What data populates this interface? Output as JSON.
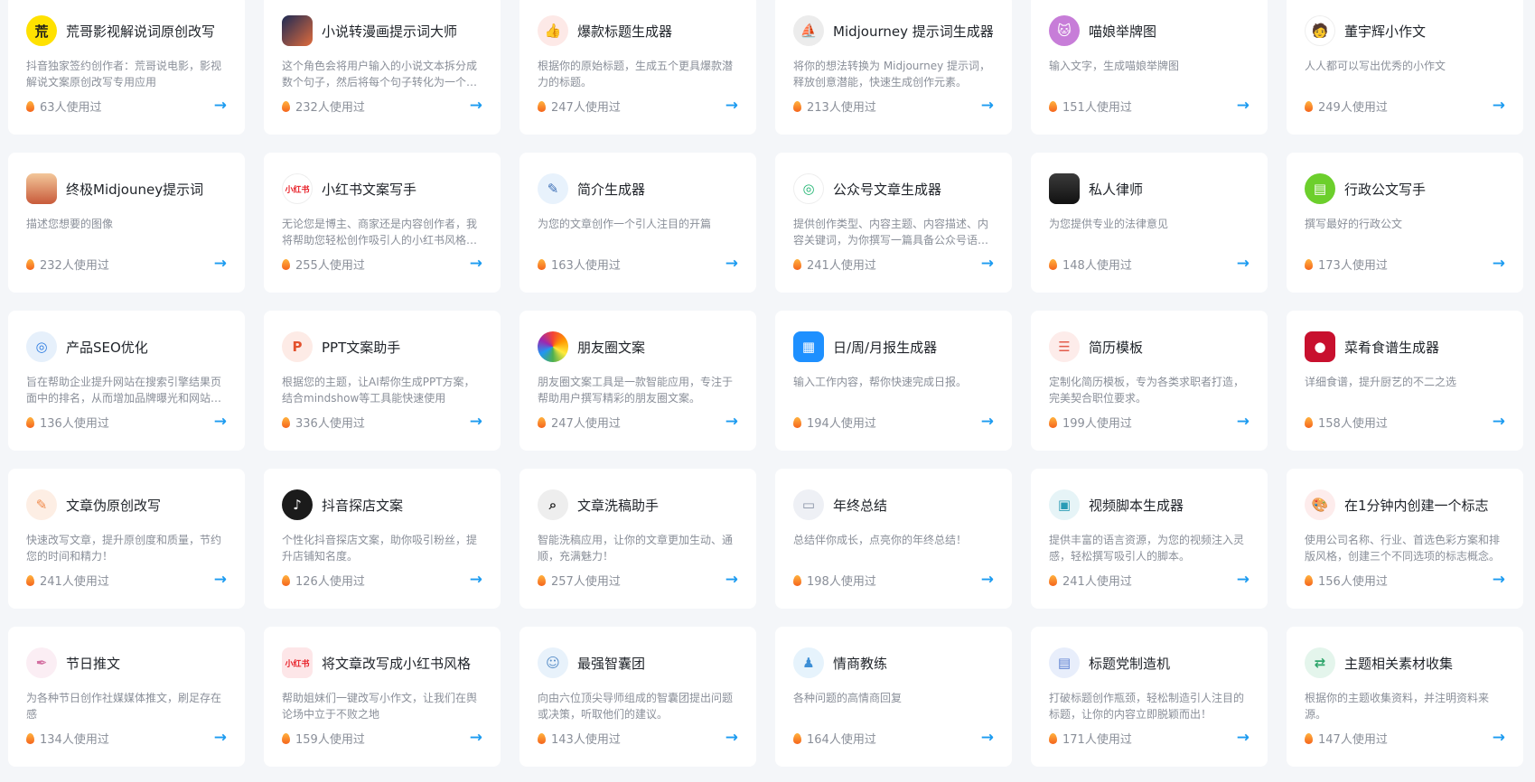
{
  "cards": [
    {
      "title": "荒哥影视解说词原创改写",
      "desc": "抖音独家签约创作者：荒哥说电影，影视解说文案原创改写专用应用",
      "uses": "63人使用过",
      "icon": "huang-ge-logo-icon",
      "glyph": "荒",
      "bg": "#ffe100",
      "fg": "#1b1b1b",
      "shape": "circle"
    },
    {
      "title": "小说转漫画提示词大师",
      "desc": "这个角色会将用户输入的小说文本拆分成数个句子，然后将每个句子转化为一个漫画分镜",
      "uses": "232人使用过",
      "icon": "comic-scene-icon",
      "glyph": "",
      "bg": "linear-gradient(135deg,#1c2a55,#e06b3c)",
      "fg": "#fff",
      "shape": "sq"
    },
    {
      "title": "爆款标题生成器",
      "desc": "根据你的原始标题，生成五个更具爆款潜力的标题。",
      "uses": "247人使用过",
      "icon": "thumbs-up-icon",
      "glyph": "👍",
      "bg": "#fde9e7",
      "fg": "#ef5b45",
      "shape": "circle"
    },
    {
      "title": "Midjourney 提示词生成器",
      "desc": "将你的想法转换为 Midjourney 提示词，释放创意潜能，快速生成创作元素。",
      "uses": "213人使用过",
      "icon": "sailboat-icon",
      "glyph": "⛵",
      "bg": "#ececec",
      "fg": "#333",
      "shape": "circle"
    },
    {
      "title": "喵娘举牌图",
      "desc": "输入文字，生成喵娘举牌图",
      "uses": "151人使用过",
      "icon": "cat-avatar-icon",
      "glyph": "🐱",
      "bg": "#c77dd8",
      "fg": "#fff",
      "shape": "circle"
    },
    {
      "title": "董宇辉小作文",
      "desc": "人人都可以写出优秀的小作文",
      "uses": "249人使用过",
      "icon": "person-avatar-icon",
      "glyph": "🧑",
      "bg": "#ffffff",
      "fg": "#333",
      "shape": "circle"
    },
    {
      "title": "终极Midjouney提示词",
      "desc": "描述您想要的图像",
      "uses": "232人使用过",
      "icon": "sunset-boat-icon",
      "glyph": "",
      "bg": "linear-gradient(180deg,#f3c79a,#c85a3a)",
      "fg": "#fff",
      "shape": "sq"
    },
    {
      "title": "小红书文案写手",
      "desc": "无论您是博主、商家还是内容创作者，我将帮助您轻松创作吸引人的小红书风格文案",
      "uses": "255人使用过",
      "icon": "xiaohongshu-logo-icon",
      "glyph": "小红书",
      "bg": "#ffffff",
      "fg": "#e8242c",
      "shape": "circle"
    },
    {
      "title": "简介生成器",
      "desc": "为您的文章创作一个引人注目的开篇",
      "uses": "163人使用过",
      "icon": "edit-document-icon",
      "glyph": "✎",
      "bg": "#e8f2fc",
      "fg": "#3d6fb6",
      "shape": "circle"
    },
    {
      "title": "公众号文章生成器",
      "desc": "提供创作类型、内容主题、内容描述、内容关键词，为你撰写一篇具备公众号语境的文章",
      "uses": "241人使用过",
      "icon": "recycle-logo-icon",
      "glyph": "◎",
      "bg": "#ffffff",
      "fg": "#22b573",
      "shape": "circle"
    },
    {
      "title": "私人律师",
      "desc": "为您提供专业的法律意见",
      "uses": "148人使用过",
      "icon": "lawyer-avatar-icon",
      "glyph": "",
      "bg": "linear-gradient(180deg,#3b3b3b,#111)",
      "fg": "#fff",
      "shape": "sq"
    },
    {
      "title": "行政公文写手",
      "desc": "撰写最好的行政公文",
      "uses": "173人使用过",
      "icon": "document-icon",
      "glyph": "▤",
      "bg": "#6ccf2c",
      "fg": "#fff",
      "shape": "circle"
    },
    {
      "title": "产品SEO优化",
      "desc": "旨在帮助企业提升网站在搜索引擎结果页面中的排名，从而增加品牌曝光和网站流量",
      "uses": "136人使用过",
      "icon": "target-icon",
      "glyph": "◎",
      "bg": "#e6f0fb",
      "fg": "#2f7de1",
      "shape": "circle"
    },
    {
      "title": "PPT文案助手",
      "desc": "根据您的主题，让AI帮你生成PPT方案，结合mindshow等工具能快速使用",
      "uses": "336人使用过",
      "icon": "ppt-icon",
      "glyph": "P",
      "bg": "#fdebe6",
      "fg": "#e3512d",
      "shape": "circle"
    },
    {
      "title": "朋友圈文案",
      "desc": "朋友圈文案工具是一款智能应用，专注于帮助用户撰写精彩的朋友圈文案。",
      "uses": "247人使用过",
      "icon": "aperture-icon",
      "glyph": "",
      "bg": "conic-gradient(#f44336,#ff9800,#ffeb3b,#4caf50,#2196f3,#9c27b0,#f44336)",
      "fg": "#fff",
      "shape": "circle"
    },
    {
      "title": "日/周/月报生成器",
      "desc": "输入工作内容，帮你快速完成日报。",
      "uses": "194人使用过",
      "icon": "calendar-icon",
      "glyph": "▦",
      "bg": "#1e90ff",
      "fg": "#fff",
      "shape": "sq"
    },
    {
      "title": "简历模板",
      "desc": "定制化简历模板，专为各类求职者打造，完美契合职位要求。",
      "uses": "199人使用过",
      "icon": "resume-icon",
      "glyph": "☰",
      "bg": "#fdecea",
      "fg": "#e35b4b",
      "shape": "circle"
    },
    {
      "title": "菜肴食谱生成器",
      "desc": "详细食谱，提升厨艺的不二之选",
      "uses": "158人使用过",
      "icon": "recipe-logo-icon",
      "glyph": "●",
      "bg": "#c8102e",
      "fg": "#fff",
      "shape": "sq"
    },
    {
      "title": "文章伪原创改写",
      "desc": "快速改写文章，提升原创度和质量，节约您的时间和精力！",
      "uses": "241人使用过",
      "icon": "rewrite-icon",
      "glyph": "✎",
      "bg": "#fdeee4",
      "fg": "#f08a4b",
      "shape": "circle"
    },
    {
      "title": "抖音探店文案",
      "desc": "个性化抖音探店文案，助你吸引粉丝，提升店铺知名度。",
      "uses": "126人使用过",
      "icon": "tiktok-icon",
      "glyph": "♪",
      "bg": "#1b1b1b",
      "fg": "#fff",
      "shape": "circle"
    },
    {
      "title": "文章洗稿助手",
      "desc": "智能洗稿应用，让你的文章更加生动、通顺，充满魅力！",
      "uses": "257人使用过",
      "icon": "search-document-icon",
      "glyph": "⌕",
      "bg": "#eeeeee",
      "fg": "#222",
      "shape": "circle"
    },
    {
      "title": "年终总结",
      "desc": "总结伴你成长，点亮你的年终总结！",
      "uses": "198人使用过",
      "icon": "report-icon",
      "glyph": "▭",
      "bg": "#eef0f5",
      "fg": "#8a93a6",
      "shape": "circle"
    },
    {
      "title": "视频脚本生成器",
      "desc": "提供丰富的语言资源，为您的视频注入灵感，轻松撰写吸引人的脚本。",
      "uses": "241人使用过",
      "icon": "video-script-icon",
      "glyph": "▣",
      "bg": "#e6f4f7",
      "fg": "#2a9bb5",
      "shape": "circle"
    },
    {
      "title": "在1分钟内创建一个标志",
      "desc": "使用公司名称、行业、首选色彩方案和排版风格，创建三个不同选项的标志概念。",
      "uses": "156人使用过",
      "icon": "palette-icon",
      "glyph": "🎨",
      "bg": "#fdecec",
      "fg": "#e5533a",
      "shape": "circle"
    },
    {
      "title": "节日推文",
      "desc": "为各种节日创作社媒媒体推文，刷足存在感",
      "uses": "134人使用过",
      "icon": "feather-pen-icon",
      "glyph": "✒",
      "bg": "#fbeef4",
      "fg": "#d36ea0",
      "shape": "circle"
    },
    {
      "title": "将文章改写成小红书风格",
      "desc": "帮助姐妹们一键改写小作文，让我们在舆论场中立于不败之地",
      "uses": "159人使用过",
      "icon": "xiaohongshu-badge-icon",
      "glyph": "小红书",
      "bg": "#fde6e8",
      "fg": "#e8242c",
      "shape": "sq"
    },
    {
      "title": "最强智囊团",
      "desc": "向由六位顶尖导师组成的智囊团提出问题或决策，听取他们的建议。",
      "uses": "143人使用过",
      "icon": "think-tank-icon",
      "glyph": "☺",
      "bg": "#e8f2fb",
      "fg": "#5a8fc8",
      "shape": "circle"
    },
    {
      "title": "情商教练",
      "desc": "各种问题的高情商回复",
      "uses": "164人使用过",
      "icon": "coach-icon",
      "glyph": "♟",
      "bg": "#e6f3fc",
      "fg": "#3d8fd6",
      "shape": "circle"
    },
    {
      "title": "标题党制造机",
      "desc": "打破标题创作瓶颈，轻松制造引人注目的标题，让你的内容立即脱颖而出！",
      "uses": "171人使用过",
      "icon": "headline-icon",
      "glyph": "▤",
      "bg": "#e8eefb",
      "fg": "#5b7fd1",
      "shape": "circle"
    },
    {
      "title": "主题相关素材收集",
      "desc": "根据你的主题收集资料，并注明资料来源。",
      "uses": "147人使用过",
      "icon": "collection-icon",
      "glyph": "⇄",
      "bg": "#e4f5ec",
      "fg": "#2ea56b",
      "shape": "circle"
    }
  ]
}
